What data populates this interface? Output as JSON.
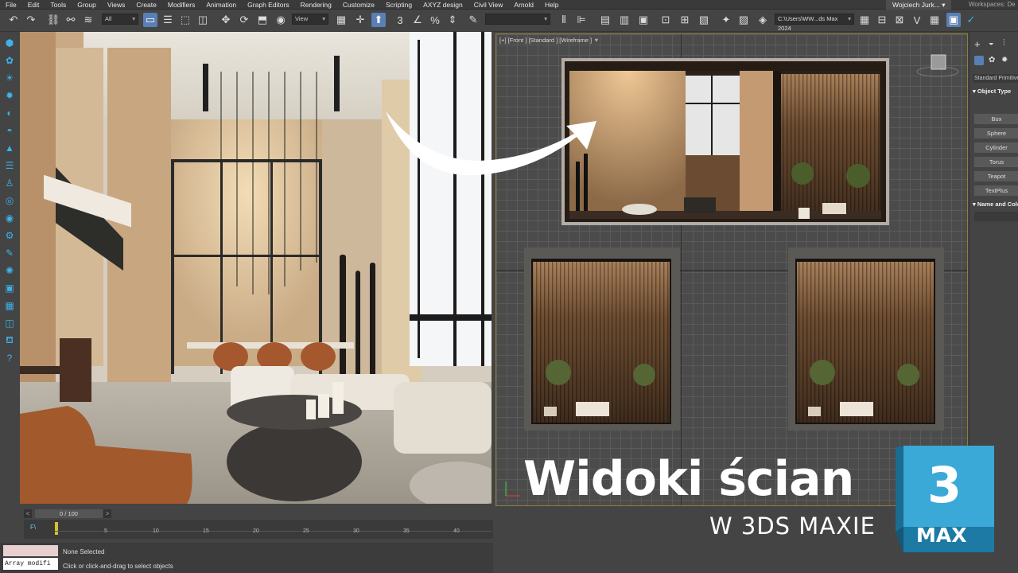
{
  "menubar": {
    "items": [
      "File",
      "Edit",
      "Tools",
      "Group",
      "Views",
      "Create",
      "Modifiers",
      "Animation",
      "Graph Editors",
      "Rendering",
      "Customize",
      "Scripting",
      "AXYZ design",
      "Civil View",
      "Arnold",
      "Help"
    ],
    "user": "Wojciech Jurk... ▾",
    "workspaces_label": "Workspaces: De"
  },
  "toolbar": {
    "selection_filter": "All",
    "ref_coord": "View",
    "path": "C:\\Users\\WW...ds Max 2024"
  },
  "viewport": {
    "label": "[+] [Front ] [Standard ] [Wireframe ]",
    "funnel": "▼"
  },
  "command_panel": {
    "dropdown": "Standard Primitives",
    "object_type_header": "Object Type",
    "buttons": [
      "Box",
      "Sphere",
      "Cylinder",
      "Torus",
      "Teapot",
      "TextPlus"
    ],
    "name_color_header": "Name and Color"
  },
  "timeline": {
    "frame_display": "0 / 100",
    "ticks": [
      "5",
      "10",
      "15",
      "20",
      "25",
      "30",
      "35",
      "40"
    ]
  },
  "status": {
    "script_field": "Array modifi",
    "selection": "None Selected",
    "prompt": "Click or click-and-drag to select objects"
  },
  "branding": {
    "title": "Widoki ścian",
    "subtitle": "W 3DS MAXIE",
    "logo_number": "3",
    "logo_text": "MAX",
    "logo_color": "#3aa9d8"
  },
  "colors": {
    "ui_bg": "#444444",
    "accent_blue": "#3db2e8",
    "viewport_border": "#8e7f3a"
  }
}
